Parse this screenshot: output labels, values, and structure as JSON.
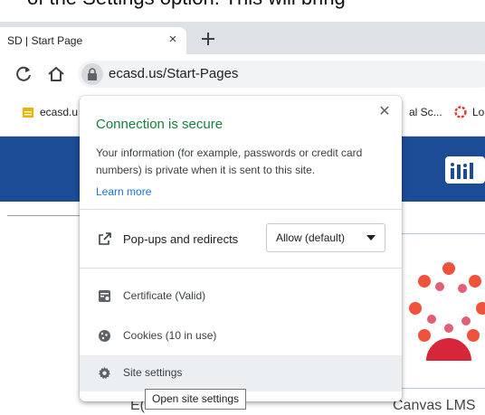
{
  "instruction_fragment": "of the Settings option. This will bring",
  "browser": {
    "tab": {
      "title": "SD | Start Page",
      "close_glyph": "×"
    },
    "new_tab_icon": "plus-icon",
    "url": "ecasd.us/Start-Pages",
    "bookmarks": [
      {
        "label": "ecasd.u",
        "icon": "folder-icon",
        "color": "#e8b400"
      },
      {
        "label": "al Sc...",
        "icon": "bookmark-icon"
      },
      {
        "label": "Lo",
        "icon": "canvas-logo-icon",
        "color": "#e5382a"
      }
    ]
  },
  "page": {
    "card_label_canvas": "Canvas LMS",
    "card_label_left": "E(",
    "banner_color": "#1c4c96"
  },
  "popup": {
    "title": "Connection is secure",
    "description": "Your information (for example, passwords or credit card numbers) is private when it is sent to this site.",
    "learn_more": "Learn more",
    "permission": {
      "label": "Pop-ups and redirects",
      "value": "Allow (default)"
    },
    "items": [
      {
        "label": "Certificate (Valid)",
        "icon": "certificate-icon"
      },
      {
        "label": "Cookies (10 in use)",
        "icon": "cookie-icon"
      },
      {
        "label": "Site settings",
        "icon": "gear-icon"
      }
    ],
    "title_color": "#188038",
    "link_color": "#1a73e8"
  },
  "tooltip": {
    "text": "Open site settings"
  }
}
